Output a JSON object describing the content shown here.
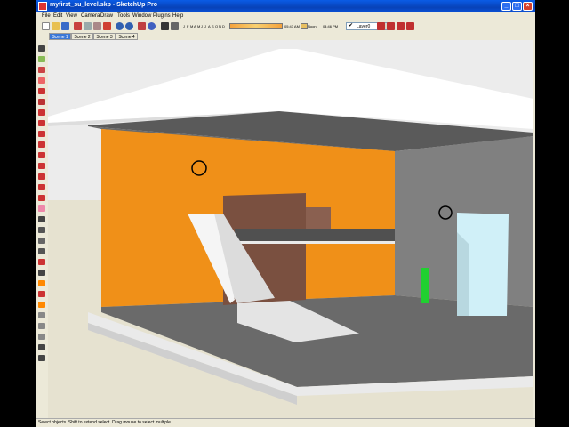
{
  "window": {
    "title": "myfirst_su_level.skp - SketchUp Pro"
  },
  "window_buttons": {
    "minimize": "_",
    "maximize": "□",
    "close": "×"
  },
  "menu": [
    "File",
    "Edit",
    "View",
    "Camera",
    "Draw",
    "Tools",
    "Window",
    "Plugins",
    "Help"
  ],
  "toolbar": {
    "months": [
      "J",
      "F",
      "M",
      "A",
      "M",
      "J",
      "J",
      "A",
      "S",
      "O",
      "N",
      "D"
    ],
    "time_left": "05:43 AM",
    "noon": "Noon",
    "time_right": "04:46 PM",
    "layer": "Layer0",
    "layer_check": "✔"
  },
  "scenes": [
    "Scene 1",
    "Scene 2",
    "Scene 3",
    "Scene 4"
  ],
  "active_scene": "Scene 1",
  "status": {
    "text": "Select objects. Shift to extend select. Drag mouse to select multiple."
  },
  "colors": {
    "titlebar": "#0a52d8",
    "orange_wall": "#f09018",
    "gray_wall": "#808080",
    "floor": "#6a6a6a"
  },
  "icons": {
    "left_tools": [
      "select-icon",
      "component-icon",
      "paint-icon",
      "eraser-icon",
      "rectangle-icon",
      "line-icon",
      "circle-icon",
      "arc-icon",
      "polygon-icon",
      "freehand-icon",
      "move-icon",
      "push-pull-icon",
      "rotate-icon",
      "follow-me-icon",
      "scale-icon",
      "offset-icon",
      "tape-icon",
      "dimension-icon",
      "protractor-icon",
      "text-icon",
      "axes-icon",
      "3d-text-icon",
      "orbit-icon",
      "pan-icon",
      "zoom-icon",
      "zoom-window-icon",
      "zoom-extents-icon",
      "walk-icon",
      "look-around-icon",
      "position-camera-icon"
    ]
  }
}
